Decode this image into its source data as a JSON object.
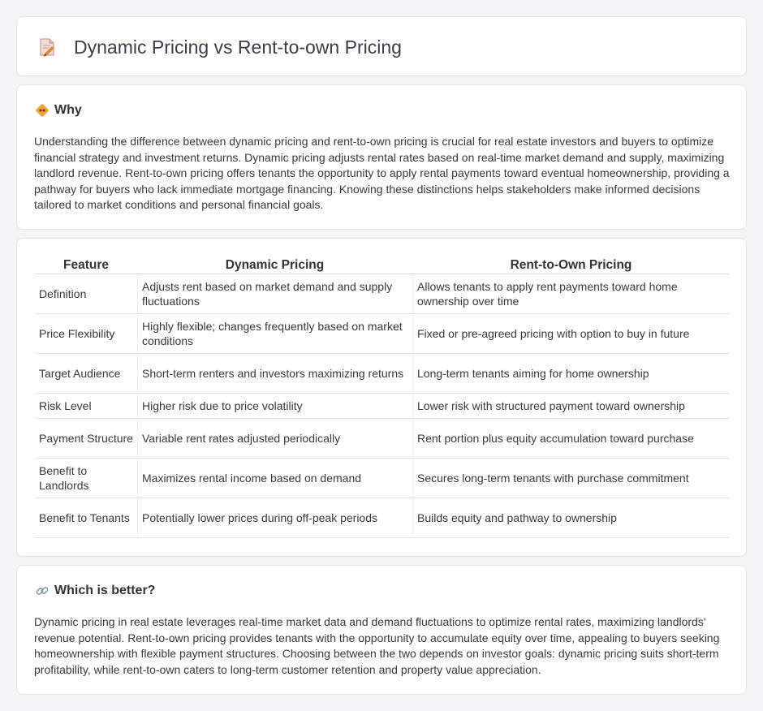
{
  "page": {
    "title": "Dynamic Pricing vs Rent-to-own Pricing"
  },
  "why": {
    "heading": "Why",
    "body": "Understanding the difference between dynamic pricing and rent-to-own pricing is crucial for real estate investors and buyers to optimize financial strategy and investment returns. Dynamic pricing adjusts rental rates based on real-time market demand and supply, maximizing landlord revenue. Rent-to-own pricing offers tenants the opportunity to apply rental payments toward eventual homeownership, providing a pathway for buyers who lack immediate mortgage financing. Knowing these distinctions helps stakeholders make informed decisions tailored to market conditions and personal financial goals."
  },
  "table": {
    "headers": [
      "Feature",
      "Dynamic Pricing",
      "Rent-to-Own Pricing"
    ],
    "rows": [
      [
        "Definition",
        "Adjusts rent based on market demand and supply fluctuations",
        "Allows tenants to apply rent payments toward home ownership over time"
      ],
      [
        "Price Flexibility",
        "Highly flexible; changes frequently based on market conditions",
        "Fixed or pre-agreed pricing with option to buy in future"
      ],
      [
        "Target Audience",
        "Short-term renters and investors maximizing returns",
        "Long-term tenants aiming for home ownership"
      ],
      [
        "Risk Level",
        "Higher risk due to price volatility",
        "Lower risk with structured payment toward ownership"
      ],
      [
        "Payment Structure",
        "Variable rent rates adjusted periodically",
        "Rent portion plus equity accumulation toward purchase"
      ],
      [
        "Benefit to Landlords",
        "Maximizes rental income based on demand",
        "Secures long-term tenants with purchase commitment"
      ],
      [
        "Benefit to Tenants",
        "Potentially lower prices during off-peak periods",
        "Builds equity and pathway to ownership"
      ]
    ]
  },
  "better": {
    "heading": "Which is better?",
    "body": "Dynamic pricing in real estate leverages real-time market data and demand fluctuations to optimize rental rates, maximizing landlords' revenue potential. Rent-to-own pricing provides tenants with the opportunity to accumulate equity over time, appealing to buyers seeking homeownership with flexible payment structures. Choosing between the two depends on investor goals: dynamic pricing suits short-term profitability, while rent-to-own caters to long-term customer retention and property value appreciation."
  }
}
